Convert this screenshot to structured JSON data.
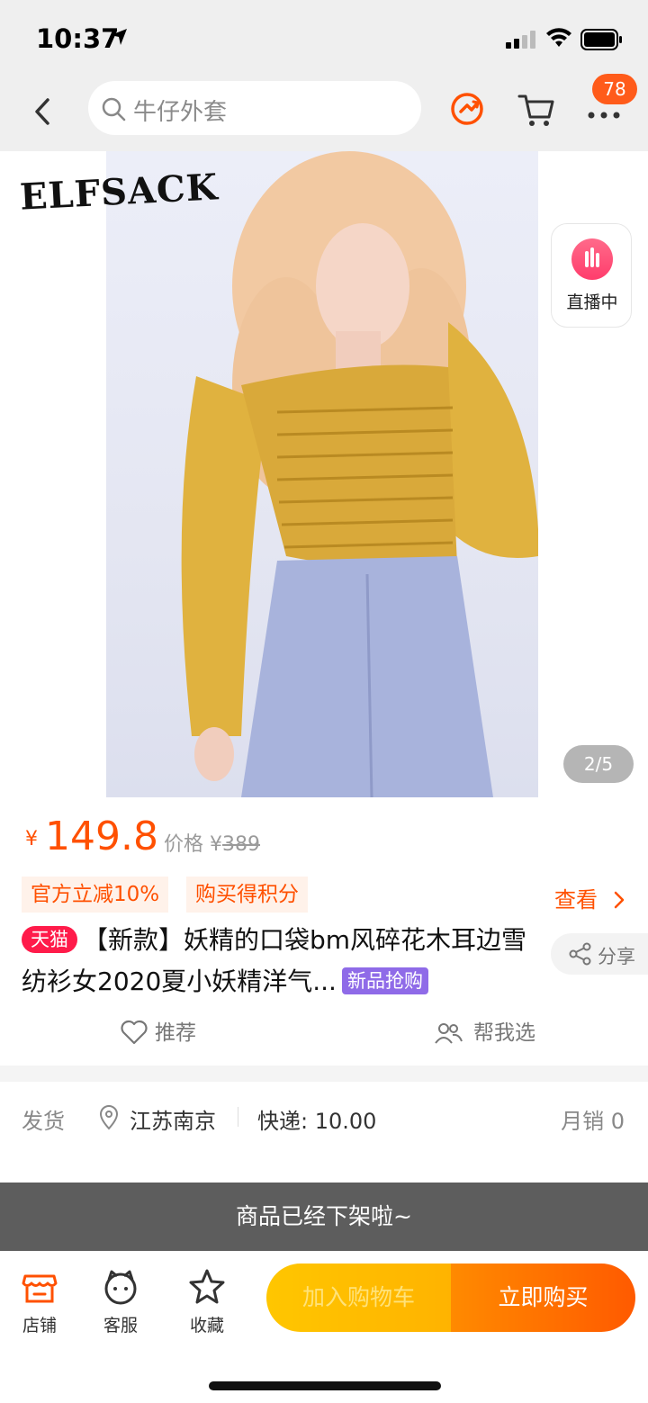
{
  "status_bar": {
    "time": "10:37"
  },
  "nav": {
    "search_placeholder": "牛仔外套",
    "cart_badge": "78"
  },
  "hero": {
    "brand_logo": "ELFSACK",
    "live_label": "直播中",
    "pager": "2/5"
  },
  "price": {
    "symbol": "¥",
    "current": "149.8",
    "original_label": "价格",
    "original_symbol": "¥",
    "original": "389"
  },
  "promos": {
    "discount": "官方立减10%",
    "points": "购买得积分",
    "view_label": "查看"
  },
  "product": {
    "store_tag": "天猫",
    "title": "【新款】妖精的口袋bm风碎花木耳边雪纺衫女2020夏小妖精洋气...",
    "new_tag": "新品抢购",
    "share_label": "分享",
    "recommend_label": "推荐",
    "help_choose_label": "帮我选"
  },
  "shipping": {
    "label": "发货",
    "city": "江苏南京",
    "fee": "快递: 10.00",
    "monthly_sales": "月销 0"
  },
  "toast": "商品已经下架啦~",
  "bottom_bar": {
    "store": "店铺",
    "service": "客服",
    "favorite": "收藏",
    "add_to_cart": "加入购物车",
    "buy_now": "立即购买"
  },
  "colors": {
    "accent": "#ff5000",
    "tmall": "#ff1b4a",
    "new_tag": "#8f6be8",
    "cart_button": "#ffc600",
    "buy_button": "#ff5a00"
  }
}
